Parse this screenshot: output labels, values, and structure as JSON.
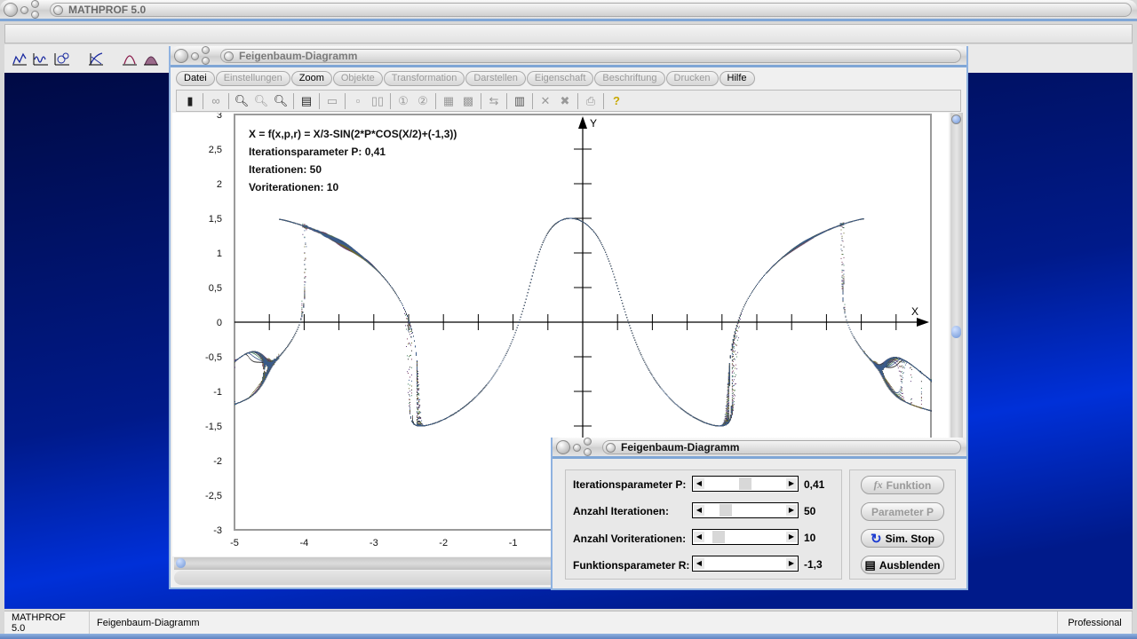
{
  "app": {
    "title": "MATHPROF 5.0",
    "toolbar_icons": [
      "function-graph-icon",
      "waves-icon",
      "parametric-icon",
      "tangent-icon",
      "curve-extremum-icon",
      "distribution-icon"
    ]
  },
  "window": {
    "title": "Feigenbaum-Diagramm",
    "menu": [
      {
        "label": "Datei",
        "enabled": true
      },
      {
        "label": "Einstellungen",
        "enabled": false
      },
      {
        "label": "Zoom",
        "enabled": true
      },
      {
        "label": "Objekte",
        "enabled": false
      },
      {
        "label": "Transformation",
        "enabled": false
      },
      {
        "label": "Darstellen",
        "enabled": false
      },
      {
        "label": "Eigenschaft",
        "enabled": false
      },
      {
        "label": "Beschriftung",
        "enabled": false
      },
      {
        "label": "Drucken",
        "enabled": false
      },
      {
        "label": "Hilfe",
        "enabled": true
      }
    ],
    "toolbar": [
      "calculator-icon",
      "glasses-icon",
      "zoom-out-icon",
      "zoom-reset-icon",
      "zoom-in-icon",
      "properties-icon",
      "window-icon",
      "box-icon",
      "two-box-icon",
      "circle-1-icon",
      "circle-2-icon",
      "table-icon",
      "copy-table-icon",
      "swap-icon",
      "pages-icon",
      "clear-icon",
      "clear-all-icon",
      "print-icon",
      "help-icon"
    ]
  },
  "plot": {
    "info": [
      "X = f(x,p,r) = X/3-SIN(2*P*COS(X/2)+(-1,3))",
      "Iterationsparameter P: 0,41",
      "Iterationen: 50",
      "Voriterationen: 10"
    ],
    "x_axis_label": "X",
    "y_axis_label": "Y"
  },
  "chart_data": {
    "type": "scatter",
    "title": "Feigenbaum-Diagramm",
    "formula": "X = X/3-SIN(2*P*COS(X/2)+(-1,3))",
    "xlabel": "X",
    "ylabel": "Y",
    "xlim": [
      -5,
      5
    ],
    "ylim": [
      -3,
      3
    ],
    "x_ticks": [
      "-5",
      "-4",
      "-3",
      "-2",
      "-1"
    ],
    "y_ticks": [
      "3",
      "2,5",
      "2",
      "1,5",
      "1",
      "0,5",
      "0",
      "-0,5",
      "-1",
      "-1,5",
      "-2",
      "-2,5",
      "-3"
    ],
    "parameters": {
      "P": 0.41,
      "R": -1.3,
      "iterations": 50,
      "preiterations": 10
    }
  },
  "dialog": {
    "title": "Feigenbaum-Diagramm",
    "sliders": [
      {
        "label": "Iterationsparameter P:",
        "value": "0,41",
        "position": 0.45
      },
      {
        "label": "Anzahl Iterationen:",
        "value": "50",
        "position": 0.2
      },
      {
        "label": "Anzahl Voriterationen:",
        "value": "10",
        "position": 0.13
      },
      {
        "label": "Funktionsparameter R:",
        "value": "-1,3",
        "position": 0.0
      }
    ],
    "buttons": [
      {
        "label": "Funktion",
        "icon": "fx-icon",
        "enabled": false
      },
      {
        "label": "Parameter P",
        "enabled": false
      },
      {
        "label": "Sim. Stop",
        "icon": "refresh-icon",
        "enabled": true
      },
      {
        "label": "Ausblenden",
        "icon": "hide-icon",
        "enabled": true
      }
    ]
  },
  "statusbar": {
    "app": "MATHPROF 5.0",
    "module": "Feigenbaum-Diagramm",
    "edition": "Professional"
  }
}
